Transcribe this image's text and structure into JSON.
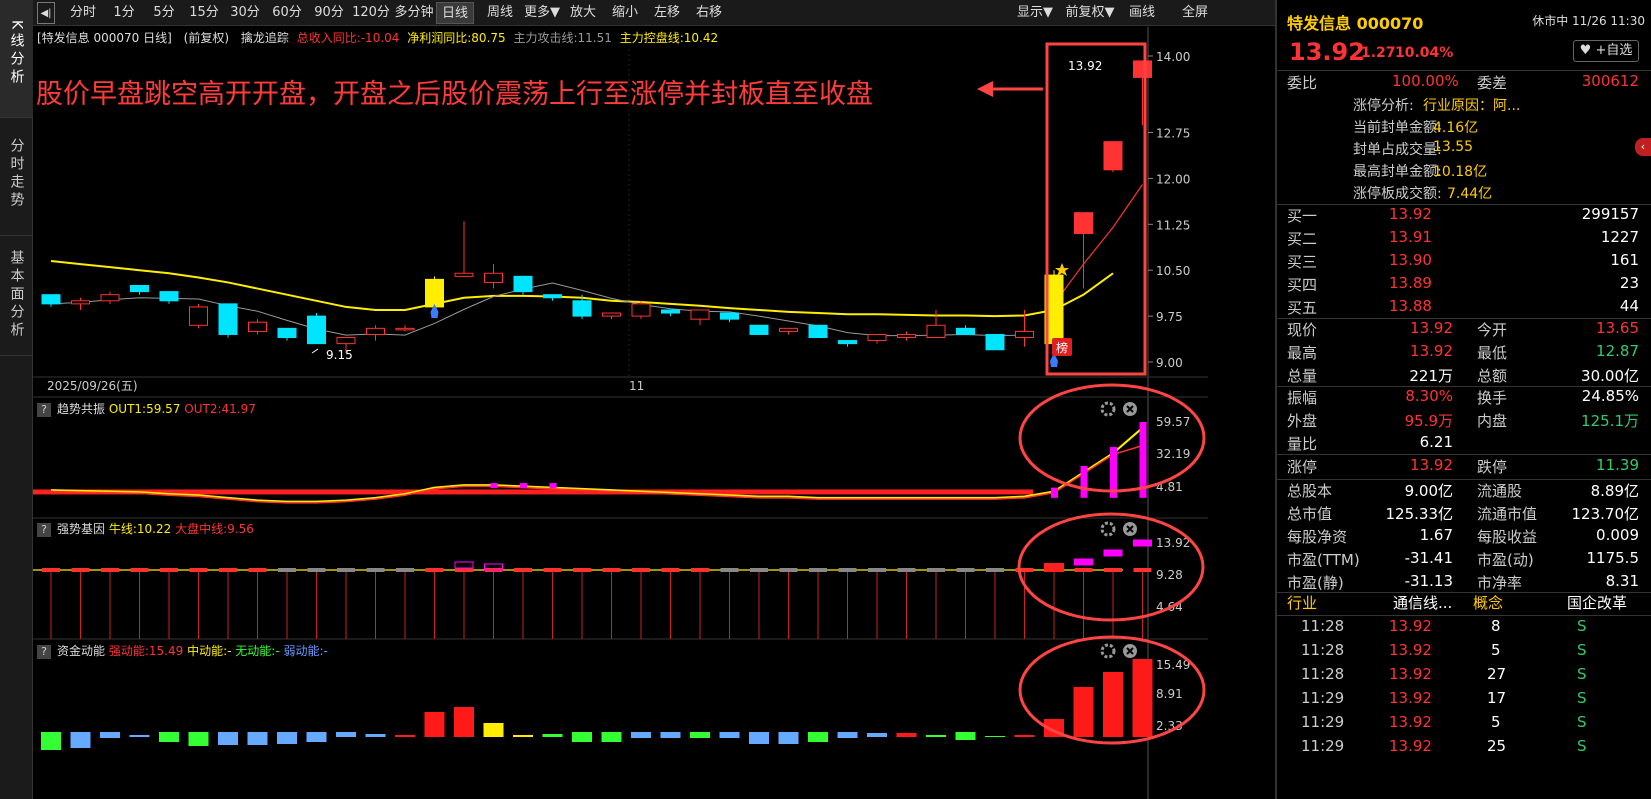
{
  "left_tabs": [
    "K线分析",
    "分时走势",
    "基本面分析"
  ],
  "toolbar": {
    "collapse_icon": "panel-collapse-icon",
    "items": [
      "分时",
      "1分",
      "5分",
      "15分",
      "30分",
      "60分",
      "90分",
      "120分",
      "多分钟",
      "日线",
      "周线",
      "更多▼",
      "放大",
      "缩小",
      "左移",
      "右移"
    ],
    "active": "日线",
    "right_items": [
      "显示▼",
      "前复权▼",
      "画线",
      "全屏"
    ]
  },
  "info": {
    "title": "[特发信息 000070 日线]",
    "adj": "(前复权)",
    "indicator": "擒龙追踪",
    "rev": "总收入同比:-10.04",
    "profit": "净利润同比:80.75",
    "attack": "主力攻击线:11.51",
    "control": "主力控盘线:10.42"
  },
  "annotation": "股价早盘跳空高开开盘，开盘之后股价震荡上行至涨停并封板直至收盘",
  "main_axis": [
    "14.00",
    "12.75",
    "12.00",
    "11.25",
    "10.50",
    "9.75",
    "9.00"
  ],
  "high_label": "13.92",
  "low_label": "9.15",
  "bang": "榜",
  "date_left": "2025/09/26(五)",
  "date_mid": "11",
  "panel1": {
    "name": "趋势共振",
    "out1": "OUT1:59.57",
    "out2": "OUT2:41.97",
    "axis": [
      "59.57",
      "32.19",
      "4.81"
    ]
  },
  "panel2": {
    "name": "强势基因",
    "bull": "牛线:10.22",
    "market": "大盘中线:9.56",
    "axis": [
      "13.92",
      "9.28",
      "4.64"
    ]
  },
  "panel3": {
    "name": "资金动能",
    "strong": "强动能:15.49",
    "mid": "中动能:-",
    "none": "无动能:-",
    "weak": "弱动能:-",
    "axis": [
      "15.49",
      "8.91",
      "2.33"
    ]
  },
  "right": {
    "name": "特发信息 000070",
    "status": "休市中 11/26 11:30",
    "price": "13.92",
    "change": "1.27",
    "pct": "10.04%",
    "fav": "+自选",
    "wb_l": "委比",
    "wb_v": "100.00%",
    "wc_l": "委差",
    "wc_v": "300612",
    "zt": [
      [
        "涨停分析:",
        "行业原因：阿..."
      ],
      [
        "当前封单金额:",
        "4.16亿"
      ],
      [
        "封单占成交量:",
        "13.55"
      ],
      [
        "最高封单金额:",
        "10.18亿"
      ],
      [
        "涨停板成交额:",
        "7.44亿"
      ]
    ],
    "buy": [
      [
        "买一",
        "13.92",
        "299157"
      ],
      [
        "买二",
        "13.91",
        "1227"
      ],
      [
        "买三",
        "13.90",
        "161"
      ],
      [
        "买四",
        "13.89",
        "23"
      ],
      [
        "买五",
        "13.88",
        "44"
      ]
    ],
    "stats1": [
      [
        "现价",
        "13.92",
        "今开",
        "13.65"
      ],
      [
        "最高",
        "13.92",
        "最低",
        "12.87"
      ],
      [
        "总量",
        "221万",
        "总额",
        "30.00亿"
      ]
    ],
    "stats2": [
      [
        "振幅",
        "8.30%",
        "换手",
        "24.85%"
      ],
      [
        "外盘",
        "95.9万",
        "内盘",
        "125.1万"
      ],
      [
        "量比",
        "6.21",
        "",
        ""
      ]
    ],
    "limit": [
      "涨停",
      "13.92",
      "跌停",
      "11.39"
    ],
    "fund": [
      [
        "总股本",
        "9.00亿",
        "流通股",
        "8.89亿"
      ],
      [
        "总市值",
        "125.33亿",
        "流通市值",
        "123.70亿"
      ],
      [
        "每股净资",
        "1.67",
        "每股收益",
        "0.009"
      ],
      [
        "市盈(TTM)",
        "-31.41",
        "市盈(动)",
        "1175.5"
      ],
      [
        "市盈(静)",
        "-31.13",
        "市净率",
        "8.31"
      ]
    ],
    "industry": [
      "行业",
      "通信线...",
      "概念",
      "国企改革"
    ],
    "ticks": [
      [
        "11:28",
        "13.92",
        "8",
        "S"
      ],
      [
        "11:28",
        "13.92",
        "5",
        "S"
      ],
      [
        "11:28",
        "13.92",
        "27",
        "S"
      ],
      [
        "11:29",
        "13.92",
        "17",
        "S"
      ],
      [
        "11:29",
        "13.92",
        "5",
        "S"
      ],
      [
        "11:29",
        "13.92",
        "25",
        "S"
      ]
    ]
  },
  "colors": {
    "up": "#ff3333",
    "down": "#00e5ff",
    "yellow": "#ffee00",
    "ma": "#aaaaaa"
  },
  "chart_data": {
    "type": "candlestick",
    "candles": [
      [
        10.1,
        10.1,
        9.9,
        9.95
      ],
      [
        9.95,
        10.05,
        9.85,
        10.0
      ],
      [
        10.0,
        10.15,
        9.95,
        10.1
      ],
      [
        10.25,
        10.25,
        10.1,
        10.15
      ],
      [
        10.15,
        10.15,
        9.95,
        10.0
      ],
      [
        9.6,
        9.95,
        9.55,
        9.9
      ],
      [
        9.95,
        9.95,
        9.4,
        9.45
      ],
      [
        9.5,
        9.7,
        9.45,
        9.65
      ],
      [
        9.55,
        9.55,
        9.35,
        9.4
      ],
      [
        9.75,
        9.8,
        9.3,
        9.3
      ],
      [
        9.3,
        9.4,
        9.15,
        9.4
      ],
      [
        9.45,
        9.6,
        9.35,
        9.55
      ],
      [
        9.55,
        9.6,
        9.5,
        9.55
      ],
      [
        9.9,
        10.4,
        9.9,
        10.35
      ],
      [
        10.4,
        11.3,
        10.4,
        10.45
      ],
      [
        10.3,
        10.6,
        10.2,
        10.45
      ],
      [
        10.4,
        10.4,
        10.1,
        10.15
      ],
      [
        10.1,
        10.1,
        10.0,
        10.05
      ],
      [
        10.0,
        10.1,
        9.7,
        9.75
      ],
      [
        9.75,
        9.8,
        9.7,
        9.8
      ],
      [
        9.75,
        10.0,
        9.7,
        9.95
      ],
      [
        9.85,
        9.85,
        9.75,
        9.8
      ],
      [
        9.7,
        9.85,
        9.6,
        9.85
      ],
      [
        9.8,
        9.8,
        9.65,
        9.7
      ],
      [
        9.6,
        9.6,
        9.45,
        9.45
      ],
      [
        9.5,
        9.55,
        9.45,
        9.55
      ],
      [
        9.6,
        9.6,
        9.4,
        9.4
      ],
      [
        9.35,
        9.35,
        9.25,
        9.3
      ],
      [
        9.35,
        9.45,
        9.3,
        9.45
      ],
      [
        9.4,
        9.5,
        9.35,
        9.45
      ],
      [
        9.4,
        9.85,
        9.4,
        9.6
      ],
      [
        9.55,
        9.6,
        9.45,
        9.45
      ],
      [
        9.45,
        9.45,
        9.2,
        9.2
      ],
      [
        9.4,
        9.85,
        9.25,
        9.5
      ],
      [
        9.3,
        10.5,
        9.3,
        10.42
      ],
      [
        11.1,
        11.44,
        10.2,
        11.44
      ],
      [
        12.14,
        12.6,
        12.1,
        12.6
      ],
      [
        13.65,
        13.92,
        12.87,
        13.92
      ]
    ]
  }
}
